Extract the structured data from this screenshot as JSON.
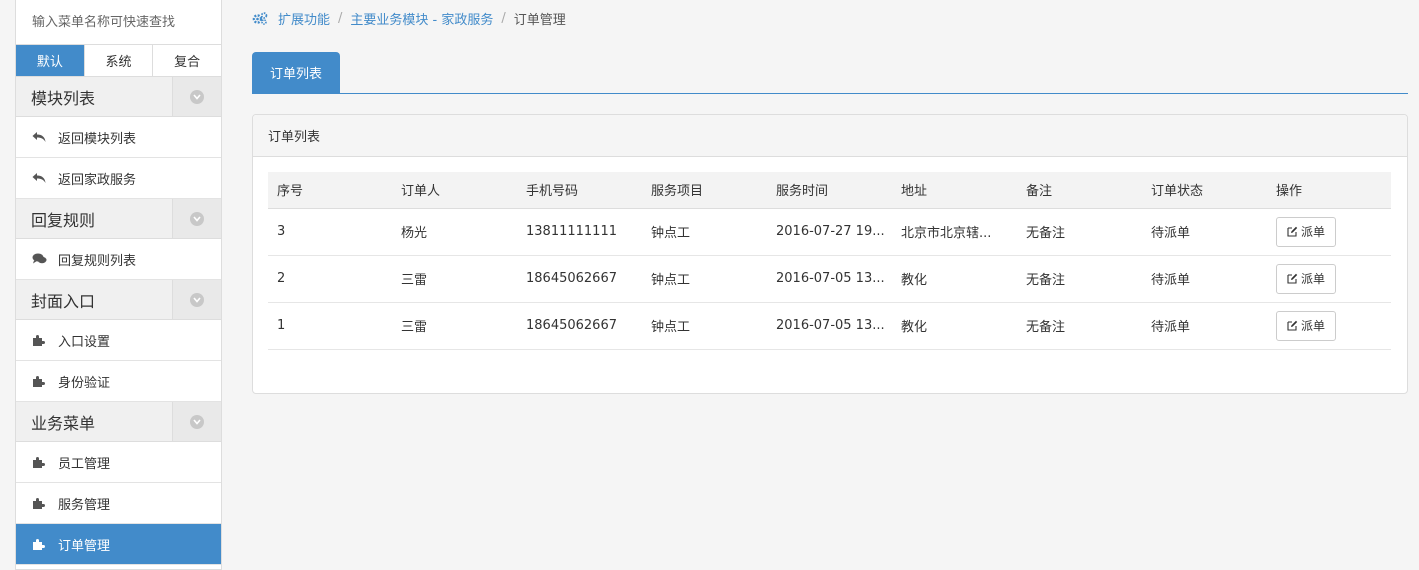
{
  "sidebar": {
    "search_placeholder": "输入菜单名称可快速查找",
    "mode_tabs": [
      "默认",
      "系统",
      "复合"
    ],
    "groups": [
      {
        "title": "模块列表",
        "items": [
          "返回模块列表",
          "返回家政服务"
        ]
      },
      {
        "title": "回复规则",
        "items": [
          "回复规则列表"
        ]
      },
      {
        "title": "封面入口",
        "items": [
          "入口设置",
          "身份验证"
        ]
      },
      {
        "title": "业务菜单",
        "items": [
          "员工管理",
          "服务管理",
          "订单管理"
        ]
      }
    ]
  },
  "breadcrumb": {
    "items": [
      "扩展功能",
      "主要业务模块 - 家政服务",
      "订单管理"
    ],
    "separator": "/"
  },
  "tab": {
    "label": "订单列表"
  },
  "panel": {
    "title": "订单列表",
    "columns": [
      "序号",
      "订单人",
      "手机号码",
      "服务项目",
      "服务时间",
      "地址",
      "备注",
      "订单状态",
      "操作"
    ],
    "rows": [
      [
        "3",
        "杨光",
        "13811111111",
        "钟点工",
        "2016-07-27 19...",
        "北京市北京辖...",
        "无备注",
        "待派单"
      ],
      [
        "2",
        "三雷",
        "18645062667",
        "钟点工",
        "2016-07-05 13...",
        "教化",
        "无备注",
        "待派单"
      ],
      [
        "1",
        "三雷",
        "18645062667",
        "钟点工",
        "2016-07-05 13...",
        "教化",
        "无备注",
        "待派单"
      ]
    ],
    "action_label": "派单"
  },
  "colors": {
    "accent": "#428bca",
    "border": "#dddddd",
    "page_bg": "#f5f5f5"
  }
}
